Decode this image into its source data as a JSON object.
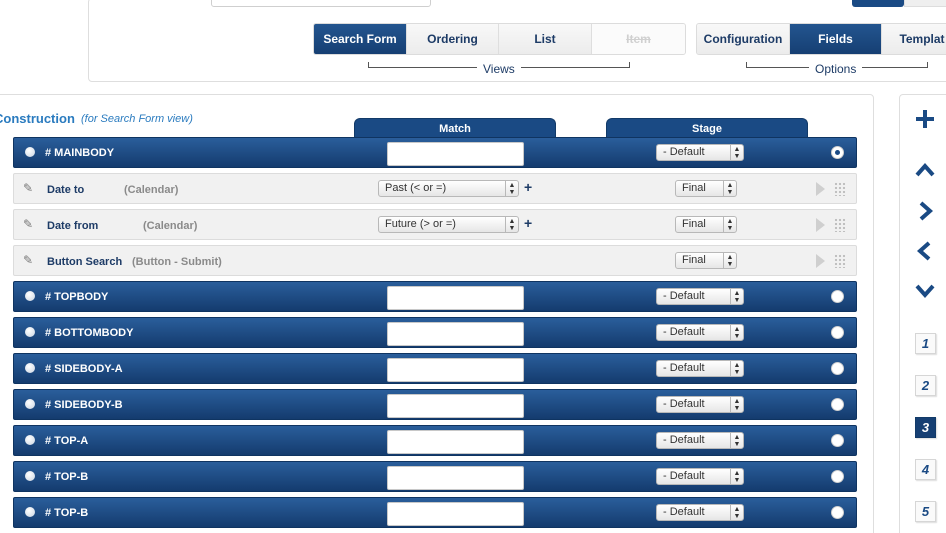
{
  "views": {
    "caption": "Views",
    "tabs": [
      {
        "label": "Search Form",
        "active": true,
        "disabled": false
      },
      {
        "label": "Ordering",
        "active": false,
        "disabled": false
      },
      {
        "label": "List",
        "active": false,
        "disabled": false
      },
      {
        "label": "Item",
        "active": false,
        "disabled": true
      }
    ]
  },
  "options": {
    "caption": "Options",
    "tabs": [
      {
        "label": "Configuration",
        "active": false
      },
      {
        "label": "Fields",
        "active": true
      },
      {
        "label": "Templat",
        "active": false
      }
    ]
  },
  "construction": {
    "title": "Construction",
    "subtitle": "(for Search Form view)",
    "col_match": "Match",
    "col_stage": "Stage"
  },
  "rows": [
    {
      "kind": "section",
      "name": "# MAINBODY",
      "stage": "- Default",
      "selected": true
    },
    {
      "kind": "field",
      "name": "Date to",
      "type": "(Calendar)",
      "match": "Past (< or =)",
      "stage": "Final"
    },
    {
      "kind": "field",
      "name": "Date from",
      "type": "(Calendar)",
      "match": "Future (> or =)",
      "stage": "Final"
    },
    {
      "kind": "field",
      "name": "Button Search",
      "type": "(Button - Submit)",
      "match": "",
      "stage": "Final"
    },
    {
      "kind": "section",
      "name": "# TOPBODY",
      "stage": "- Default",
      "selected": false
    },
    {
      "kind": "section",
      "name": "# BOTTOMBODY",
      "stage": "- Default",
      "selected": false
    },
    {
      "kind": "section",
      "name": "# SIDEBODY-A",
      "stage": "- Default",
      "selected": false
    },
    {
      "kind": "section",
      "name": "# SIDEBODY-B",
      "stage": "- Default",
      "selected": false
    },
    {
      "kind": "section",
      "name": "# TOP-A",
      "stage": "- Default",
      "selected": false
    },
    {
      "kind": "section",
      "name": "# TOP-B",
      "stage": "- Default",
      "selected": false
    },
    {
      "kind": "section",
      "name": "# TOP-B",
      "stage": "- Default",
      "selected": false
    }
  ],
  "sidebar": {
    "icons": [
      "plus-icon",
      "arrow-up-icon",
      "arrow-right-icon",
      "arrow-left-icon",
      "arrow-down-icon"
    ],
    "pages": [
      "1",
      "2",
      "3",
      "4",
      "5"
    ],
    "active_page": "3"
  },
  "colors": {
    "navy": "#1a4a84",
    "link_blue": "#2a7bbf"
  }
}
